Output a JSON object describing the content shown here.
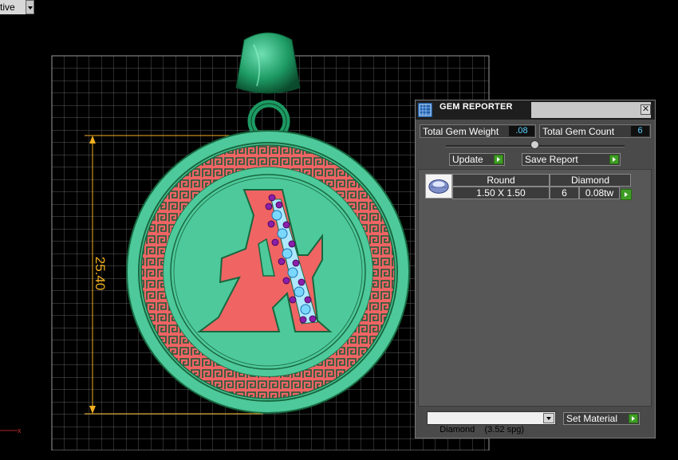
{
  "viewport": {
    "mode_label": "ctive",
    "dimension_value": "25.40"
  },
  "gem_reporter": {
    "title": "GEM REPORTER",
    "close_glyph": "✕",
    "total_gem_weight_label": "Total Gem Weight",
    "total_gem_weight_value": ".08",
    "total_gem_count_label": "Total Gem Count",
    "total_gem_count_value": "6",
    "update_label": "Update",
    "save_report_label": "Save Report",
    "gems": [
      {
        "shape": "Round",
        "material": "Diamond",
        "size": "1.50 X 1.50",
        "count": "6",
        "weight": "0.08tw"
      }
    ],
    "material_selected": "Diamond    (3.52 spg)",
    "set_material_label": "Set Material"
  },
  "colors": {
    "pendant": "#4ec99b",
    "pendant_dark": "#17683f",
    "letter": "#f06464",
    "grid": "#7a7a7a",
    "dimension": "#f0b020",
    "gem_blue": "#7ad8ff",
    "gem_purple": "#8a1faa",
    "button_go": "#3f9e24",
    "value_text": "#5bd2ff"
  },
  "icons": {
    "panel_logo": "gem-reporter-logo-icon",
    "close": "close-icon",
    "go_arrow": "play-arrow-icon",
    "dropdown": "chevron-down-icon",
    "gem_thumbnail": "round-diamond-icon"
  }
}
